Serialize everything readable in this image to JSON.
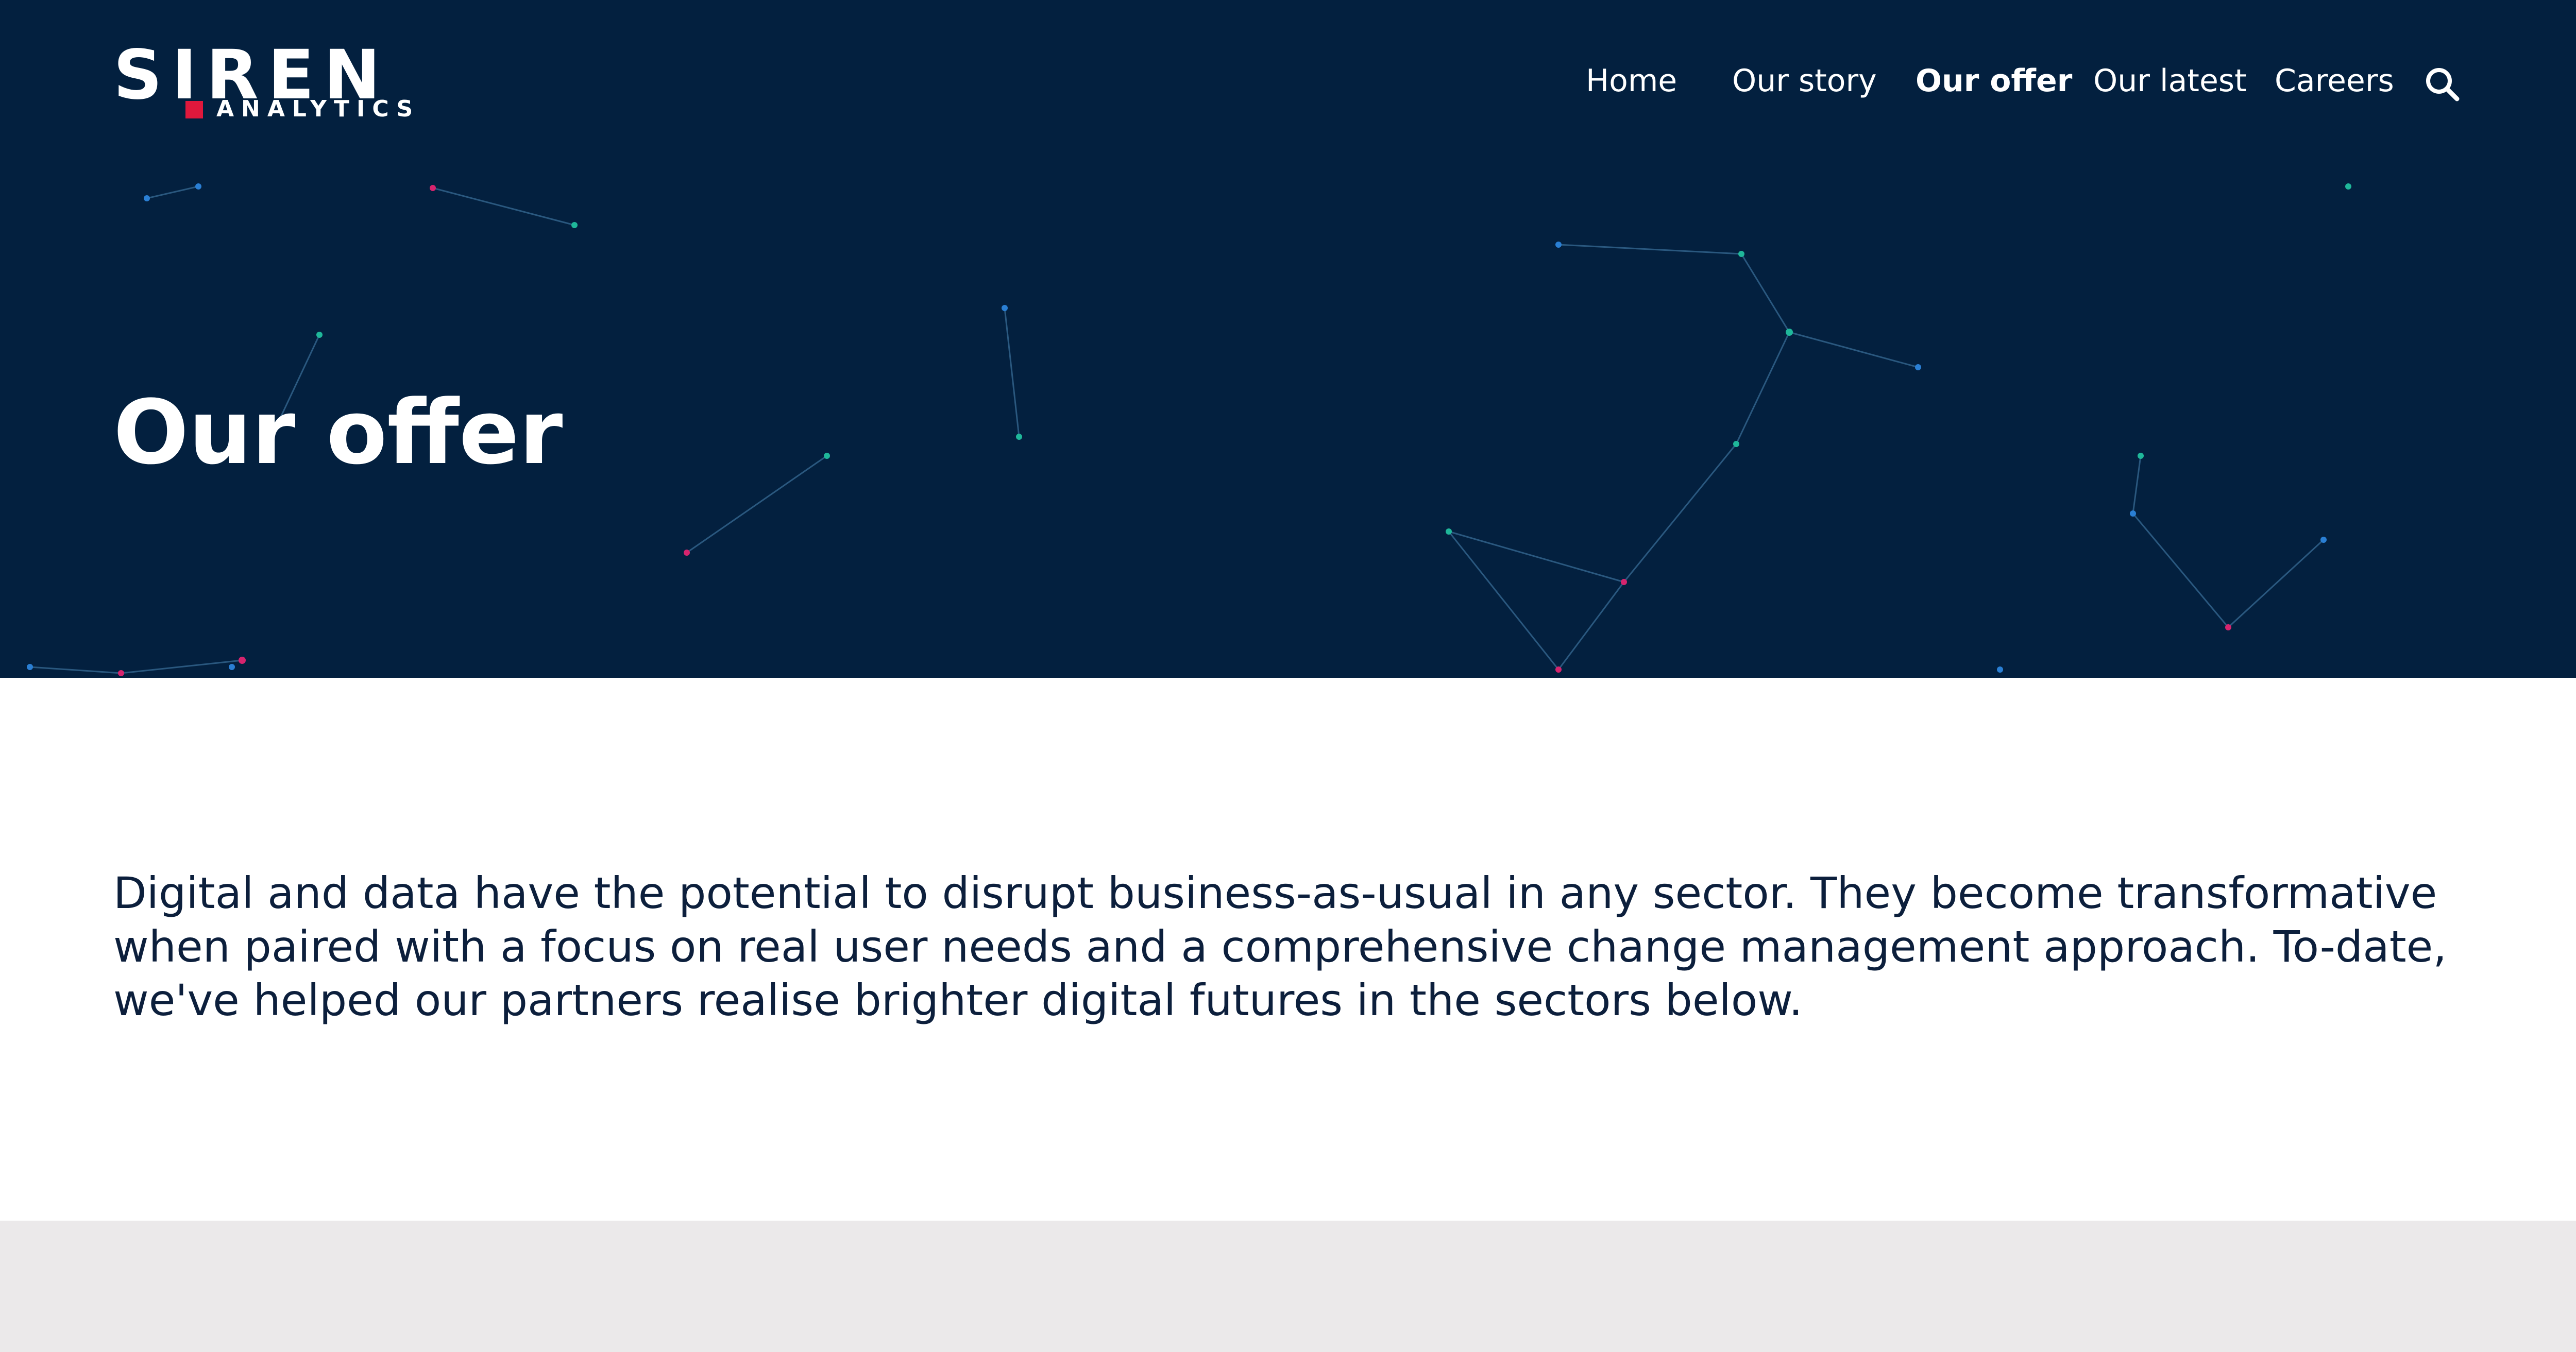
{
  "header": {
    "logo": {
      "brand": "SIREN",
      "tagline": "ANALYTICS"
    },
    "nav": {
      "items": [
        {
          "label": "Home",
          "active": false
        },
        {
          "label": "Our story",
          "active": false
        },
        {
          "label": "Our offer",
          "active": true
        },
        {
          "label": "Our latest",
          "active": false
        },
        {
          "label": "Careers",
          "active": false
        }
      ],
      "search_icon": "search-icon"
    }
  },
  "hero": {
    "title": "Our offer",
    "background_decoration": "network-constellation"
  },
  "main": {
    "intro": "Digital and data have the potential to disrupt business-as-usual in any sector. They become transformative when paired with a focus on real user needs and a comprehensive change management approach. To-date, we've helped our partners realise brighter digital futures in the sectors below."
  },
  "colors": {
    "hero_background": "#03203f",
    "brand_accent": "#e0183c",
    "node_teal": "#1fb79a",
    "node_blue": "#2a7fd4",
    "node_pink": "#d6246e",
    "body_text": "#0c1f3c",
    "sectors_band": "#ebe9ea"
  }
}
